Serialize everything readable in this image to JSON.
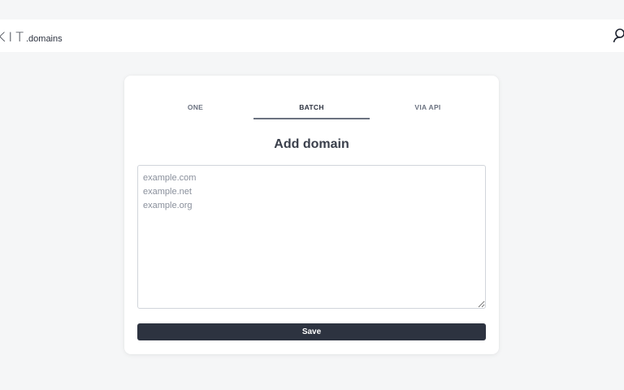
{
  "header": {
    "logo_mark": "KIT",
    "logo_suffix": ".domains",
    "user_icon": "user-icon"
  },
  "tabs": [
    {
      "label": "ONE",
      "active": false
    },
    {
      "label": "BATCH",
      "active": true
    },
    {
      "label": "VIA API",
      "active": false
    }
  ],
  "form": {
    "title": "Add domain",
    "placeholder": "example.com\nexample.net\nexample.org",
    "value": "",
    "save_label": "Save"
  },
  "colors": {
    "background": "#f5f6f7",
    "card": "#ffffff",
    "button": "#2d3340",
    "accent_underline": "#6b7280"
  }
}
